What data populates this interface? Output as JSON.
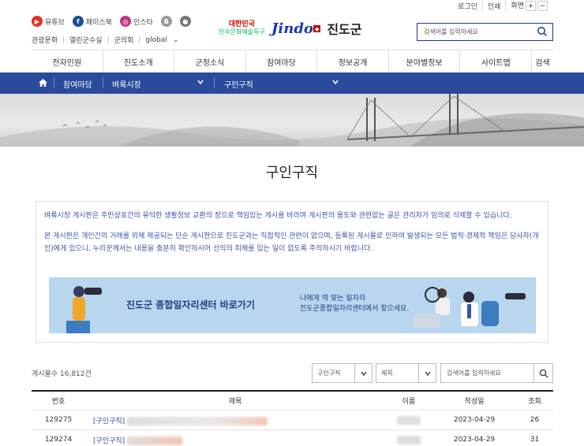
{
  "util": {
    "login": "로그인",
    "print": "인쇄",
    "screen": "화면",
    "zoom_in": "+",
    "zoom_out": "−"
  },
  "sns": [
    {
      "label": "유튜브",
      "icon": "youtube-icon",
      "color": "#e52d27"
    },
    {
      "label": "페이스북",
      "icon": "facebook-icon",
      "color": "#1b4f9c"
    },
    {
      "label": "인스타",
      "icon": "instagram-icon",
      "color": "#c13584"
    },
    {
      "label": "B",
      "icon": "blog-icon",
      "color": "#999999"
    },
    {
      "label": "",
      "icon": "kakao-icon",
      "color": "#777777"
    }
  ],
  "links": [
    "관광문화",
    "열린군수실",
    "군의회",
    "global"
  ],
  "logo": {
    "line1": "대한민국",
    "line2": "민속문화예술특구",
    "brand": "Jindo",
    "name": "진도군"
  },
  "header_search": {
    "placeholder": "검색어를 입력하세요"
  },
  "gnb": [
    "전자민원",
    "진도소개",
    "군정소식",
    "참여마당",
    "정보공개",
    "분야별정보",
    "사이트맵",
    "검색"
  ],
  "breadcrumb": [
    "참여마당",
    "벼룩시장",
    "구인구직"
  ],
  "page_title": "구인구직",
  "notice": {
    "p1": "벼룩시장 게시판은 주민상호간의 유익한 생활정보 교환의 장으로 책임있는 게시를 바라며 게시판의 용도와 관련없는 글은 관리자가 임의로 삭제할 수 있습니다.",
    "p2": "본 게시판은 개인간의 거래를 위해 제공되는 단순 게시판으로 진도군과는 직접적인 관련이 없으며, 등록된 게시물로 인하여 발생되는 모든 법적·경제적 책임은 당사자(개인)에게 있으니, 누리꾼께서는 내용을 충분히 확인하시어 선의의 피해를 입는 일이 없도록 주의하시기 바랍니다."
  },
  "banner": {
    "title": "진도군 종합일자리센터 바로가기",
    "sub1": "나에게 딱 맞는 일자리",
    "sub2": "진도군종합일자리센터에서 찾으세요."
  },
  "list": {
    "count_label": "게시물수 16,812건",
    "category_select": "구인구직",
    "field_select": "제목",
    "search_placeholder": "검색어를 입력하세요"
  },
  "table": {
    "headers": [
      "번호",
      "제목",
      "이름",
      "작성일",
      "조회"
    ],
    "rows": [
      {
        "no": "129275",
        "category": "[구인구직]",
        "date": "2023-04-29",
        "views": "26"
      },
      {
        "no": "129274",
        "category": "[구인구직]",
        "date": "2023-04-29",
        "views": "31"
      }
    ]
  },
  "colors": {
    "brand_blue": "#2a4a9c",
    "notice_text": "#3a55a8"
  }
}
